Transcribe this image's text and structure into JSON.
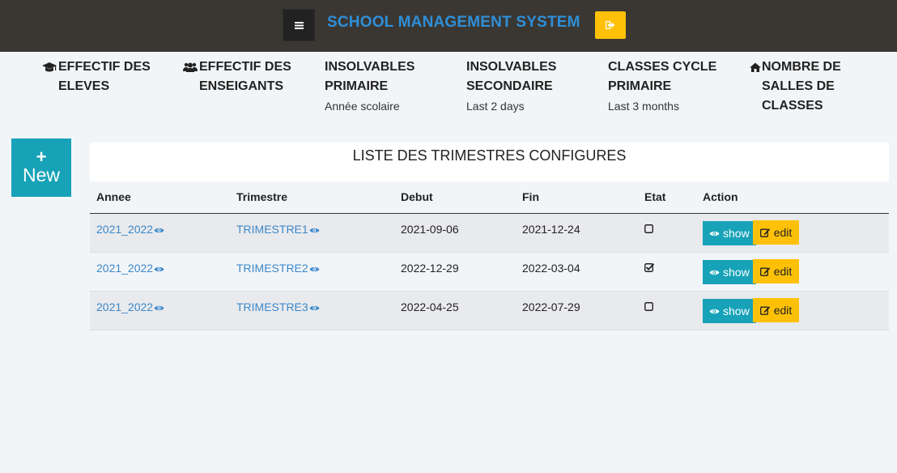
{
  "header": {
    "title": "SCHOOL MANAGEMENT SYSTEM",
    "menu_icon": "bars-icon",
    "logout_icon": "sign-out-icon",
    "logout_color": "#ffc107"
  },
  "stats": [
    {
      "icon": "graduation-cap-icon",
      "label": "EFFECTIF DES\nELEVES",
      "sub": ""
    },
    {
      "icon": "users-icon",
      "label": "EFFECTIF DES\nENSEIGANTS",
      "sub": ""
    },
    {
      "icon": "",
      "label": "INSOLVABLES\nPRIMAIRE",
      "sub": "Année scolaire"
    },
    {
      "icon": "",
      "label": "INSOLVABLES\nSECONDAIRE",
      "sub": "Last 2 days"
    },
    {
      "icon": "",
      "label": "CLASSES CYCLE\nPRIMAIRE",
      "sub": "Last 3 months"
    },
    {
      "icon": "home-icon",
      "label": "NOMBRE DE\nSALLES DE\nCLASSES",
      "sub": ""
    }
  ],
  "new_button": {
    "plus": "+",
    "label": "New",
    "color": "#17a2b8"
  },
  "table": {
    "title": "LISTE DES TRIMESTRES CONFIGURES",
    "columns": [
      "Annee",
      "Trimestre",
      "Debut",
      "Fin",
      "Etat",
      "Action"
    ],
    "rows": [
      {
        "annee": "2021_2022",
        "trimestre": "TRIMESTRE1",
        "debut": "2021-09-06",
        "fin": "2021-12-24",
        "etat": false
      },
      {
        "annee": "2021_2022",
        "trimestre": "TRIMESTRE2",
        "debut": "2022-12-29",
        "fin": "2022-03-04",
        "etat": true
      },
      {
        "annee": "2021_2022",
        "trimestre": "TRIMESTRE3",
        "debut": "2022-04-25",
        "fin": "2022-07-29",
        "etat": false
      }
    ],
    "show_label": "show",
    "edit_label": "edit"
  }
}
